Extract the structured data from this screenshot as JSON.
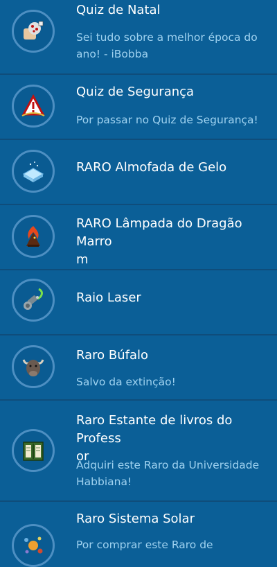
{
  "badges": [
    {
      "title": "Quiz de Natal",
      "description": "Sei tudo sobre a melhor época do\nano! - iBobba",
      "icon": "dice-hand-icon"
    },
    {
      "title": "Quiz de Segurança",
      "description": "Por passar no Quiz de Segurança!",
      "icon": "warning-shield-icon"
    },
    {
      "title": "RARO Almofada de Gelo",
      "description": "",
      "icon": "ice-cushion-icon"
    },
    {
      "title": "RARO Lâmpada do Dragão Marro\nm",
      "description": "",
      "icon": "dragon-lamp-icon"
    },
    {
      "title": "Raio Laser",
      "description": "",
      "icon": "laser-icon"
    },
    {
      "title": "Raro Búfalo",
      "description": "Salvo da extinção!",
      "icon": "buffalo-icon"
    },
    {
      "title": "Raro Estante de livros do Profess\nor",
      "description": "Adquiri este Raro da Universidade\nHabbiana!",
      "icon": "bookshelf-icon"
    },
    {
      "title": "Raro Sistema Solar",
      "description": "Por comprar este Raro de",
      "icon": "solar-system-icon"
    }
  ]
}
